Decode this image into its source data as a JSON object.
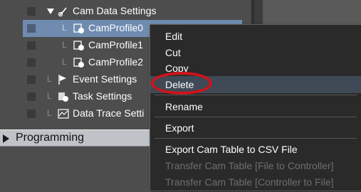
{
  "tree": {
    "items": [
      {
        "label": "Cam Data Settings"
      },
      {
        "label": "CamProfile0"
      },
      {
        "label": "CamProfile1"
      },
      {
        "label": "CamProfile2"
      },
      {
        "label": "Event Settings"
      },
      {
        "label": "Task Settings"
      },
      {
        "label": "Data Trace Setti"
      }
    ]
  },
  "section": {
    "label": "Programming"
  },
  "context_menu": {
    "items": [
      {
        "label": "Edit",
        "enabled": true
      },
      {
        "label": "Cut",
        "enabled": true
      },
      {
        "label": "Copy",
        "enabled": true
      },
      {
        "label": "Delete",
        "enabled": true,
        "highlighted": true
      },
      {
        "label": "Rename",
        "enabled": true
      },
      {
        "label": "Export",
        "enabled": true
      },
      {
        "label": "Export Cam Table to CSV File",
        "enabled": true
      },
      {
        "label": "Transfer Cam Table [File to Controller]",
        "enabled": false
      },
      {
        "label": "Transfer Cam Table [Controller to File]",
        "enabled": false
      }
    ]
  },
  "colors": {
    "highlight_ring": "#d0131b",
    "selection": "#6f8bb0"
  }
}
